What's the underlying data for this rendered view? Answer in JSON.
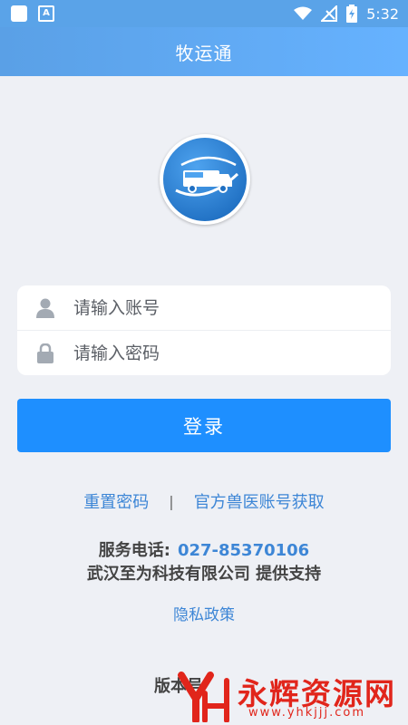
{
  "status_bar": {
    "time": "5:32",
    "icons": [
      "app-square-icon",
      "keyboard-a-icon",
      "wifi-icon",
      "no-signal-icon",
      "battery-charging-icon"
    ]
  },
  "app_bar": {
    "title": "牧运通"
  },
  "logo": {
    "icon": "truck-logo-icon",
    "color": "#2f86dc"
  },
  "login_form": {
    "account": {
      "placeholder": "请输入账号",
      "value": "",
      "icon": "user-icon"
    },
    "password": {
      "placeholder": "请输入密码",
      "value": "",
      "icon": "lock-icon"
    },
    "submit_label": "登录"
  },
  "links": {
    "reset_password": "重置密码",
    "separator": "|",
    "vet_account": "官方兽医账号获取"
  },
  "service": {
    "label": "服务电话:",
    "phone": "027-85370106"
  },
  "company_support": "武汉至为科技有限公司 提供支持",
  "privacy_policy": "隐私政策",
  "version_label": "版本号",
  "watermark": {
    "text": "永辉资源网",
    "url": "www.yhkjjj.com"
  },
  "colors": {
    "app_bar": "#5aa0e6",
    "primary_button": "#1e8fff",
    "link": "#3d86d6",
    "background": "#eef0f5",
    "watermark": "#e1251b"
  }
}
